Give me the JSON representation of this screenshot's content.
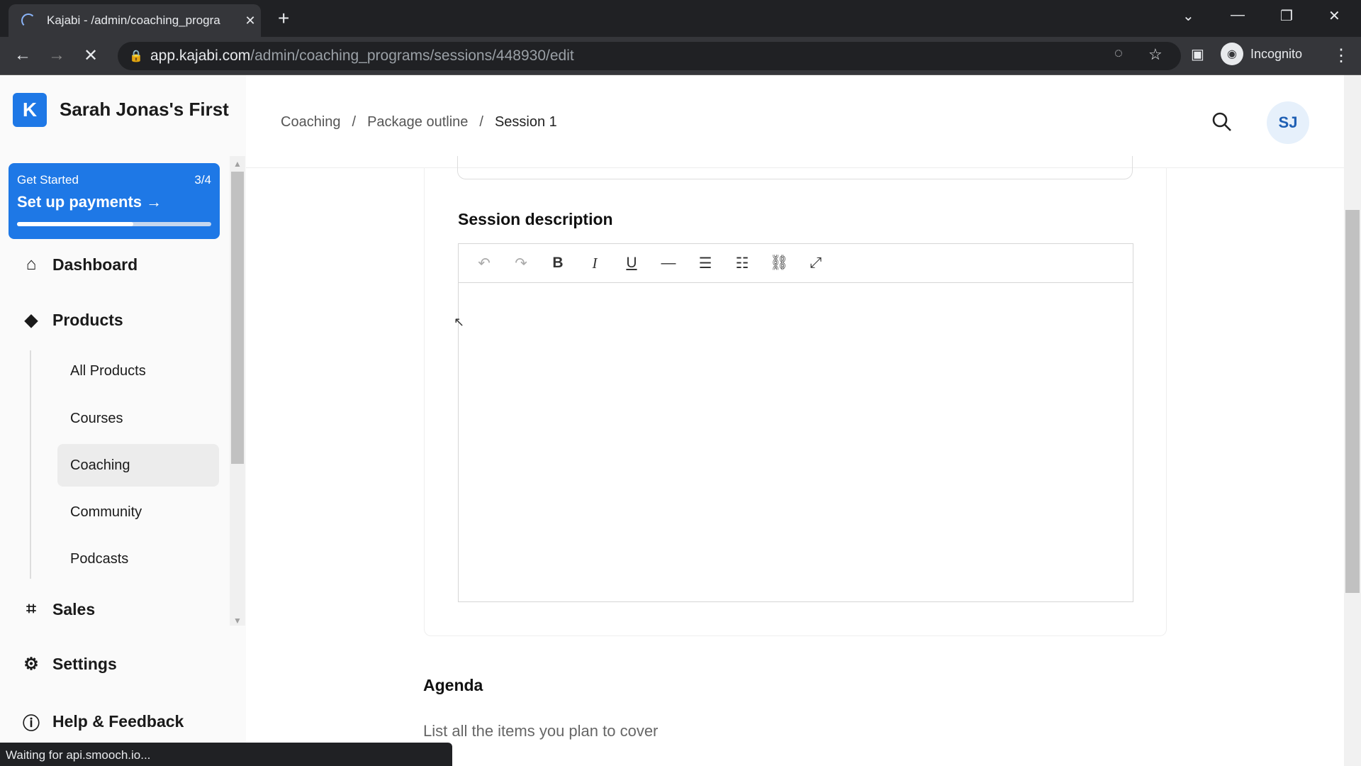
{
  "browser": {
    "tab_title": "Kajabi - /admin/coaching_progra",
    "url_host": "app.kajabi.com",
    "url_path": "/admin/coaching_programs/sessions/448930/edit",
    "profile": "Incognito",
    "status": "Waiting for api.smooch.io..."
  },
  "sidebar": {
    "site_name": "Sarah Jonas's First",
    "get_started": {
      "label": "Get Started",
      "count": "3/4",
      "action": "Set up payments",
      "progress": 0.6
    },
    "nav": [
      {
        "label": "Dashboard",
        "icon": "home-icon"
      },
      {
        "label": "Products",
        "icon": "box-icon"
      },
      {
        "label": "Sales",
        "icon": "tag-icon"
      },
      {
        "label": "Settings",
        "icon": "gear-icon"
      },
      {
        "label": "Help & Feedback",
        "icon": "help-icon"
      }
    ],
    "products_sub": [
      "All Products",
      "Courses",
      "Coaching",
      "Community",
      "Podcasts"
    ],
    "active": "Coaching"
  },
  "header": {
    "breadcrumb": [
      "Coaching",
      "Package outline",
      "Session 1"
    ],
    "avatar": "SJ"
  },
  "main": {
    "session_description_label": "Session description",
    "agenda_title": "Agenda",
    "agenda_subtitle": "List all the items you plan to cover"
  },
  "colors": {
    "brand": "#1e78e6"
  }
}
